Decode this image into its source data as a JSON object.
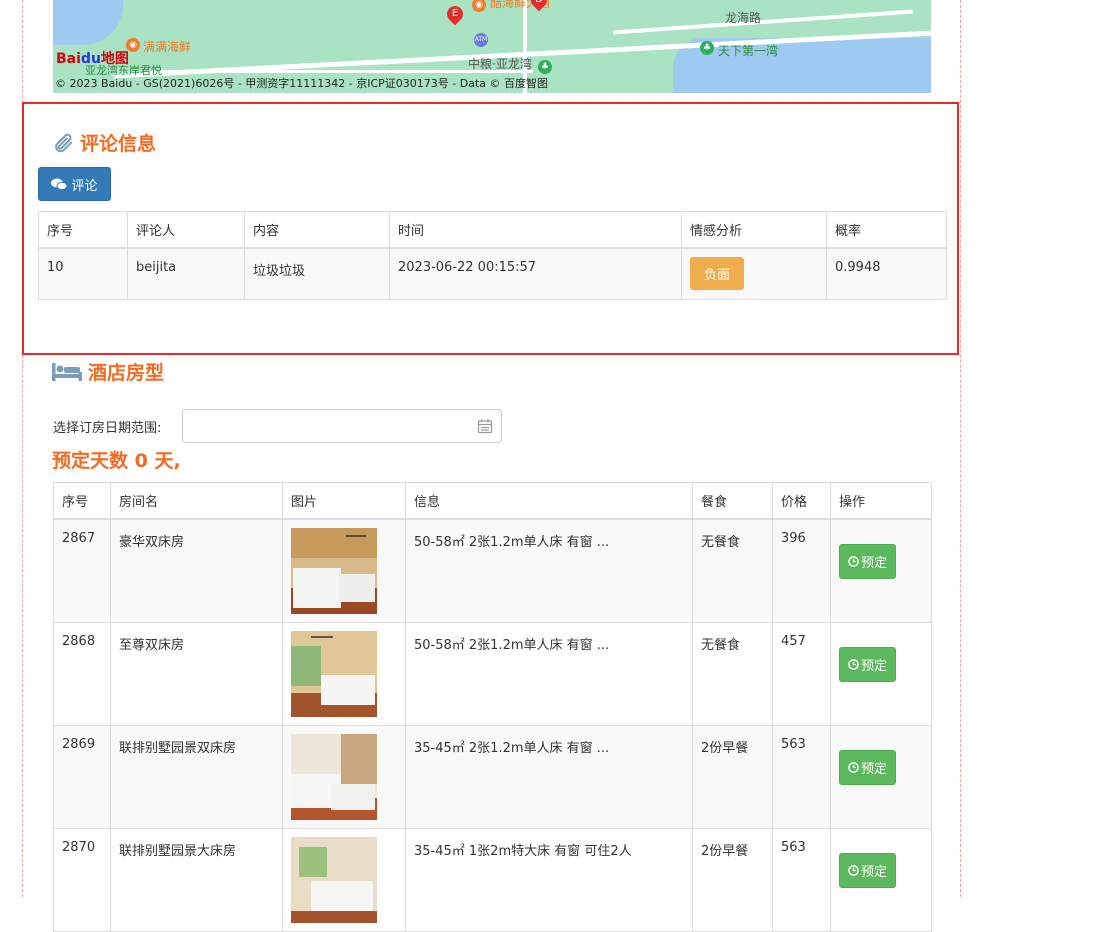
{
  "map": {
    "copyright": "© 2023 Baidu - GS(2021)6026号 - 甲测资字11111342 - 京ICP证030173号 - Data © 百度智图",
    "logo": "Bai地图",
    "pois": [
      "满满海鲜",
      "龙海路",
      "天下第一湾",
      "中粮·亚龙湾",
      "醋海鲜大酒",
      "亚龙湾东岸君悦"
    ]
  },
  "comments": {
    "title": "评论信息",
    "title_icon": "paperclip-icon",
    "comment_button": "评论",
    "columns": [
      "序号",
      "评论人",
      "内容",
      "时间",
      "情感分析",
      "概率"
    ],
    "rows": [
      {
        "id": "10",
        "user": "beijita",
        "content": "垃圾垃圾",
        "time": "2023-06-22 00:15:57",
        "sentiment": "负面",
        "prob": "0.9948"
      }
    ]
  },
  "rooms": {
    "title": "酒店房型",
    "title_icon": "bed-icon",
    "date_label": "选择订房日期范围:",
    "date_value": "",
    "days_text": "预定天数 0 天,",
    "columns": [
      "序号",
      "房间名",
      "图片",
      "信息",
      "餐食",
      "价格",
      "操作"
    ],
    "book_label": "预定",
    "rows": [
      {
        "id": "2867",
        "name": "豪华双床房",
        "info": "50-58㎡ 2张1.2m单人床 有窗 ...",
        "meal": "无餐食",
        "price": "396"
      },
      {
        "id": "2868",
        "name": "至尊双床房",
        "info": "50-58㎡ 2张1.2m单人床 有窗 ...",
        "meal": "无餐食",
        "price": "457"
      },
      {
        "id": "2869",
        "name": "联排别墅园景双床房",
        "info": "35-45㎡ 2张1.2m单人床 有窗 ...",
        "meal": "2份早餐",
        "price": "563"
      },
      {
        "id": "2870",
        "name": "联排别墅园景大床房",
        "info": "35-45㎡ 1张2m特大床 有窗 可住2人",
        "meal": "2份早餐",
        "price": "563"
      }
    ]
  },
  "colors": {
    "accent": "#f26b22",
    "primary": "#337ab7",
    "warning": "#f0ad4e",
    "success": "#5cb85c",
    "highlight": "#e32b2b"
  }
}
